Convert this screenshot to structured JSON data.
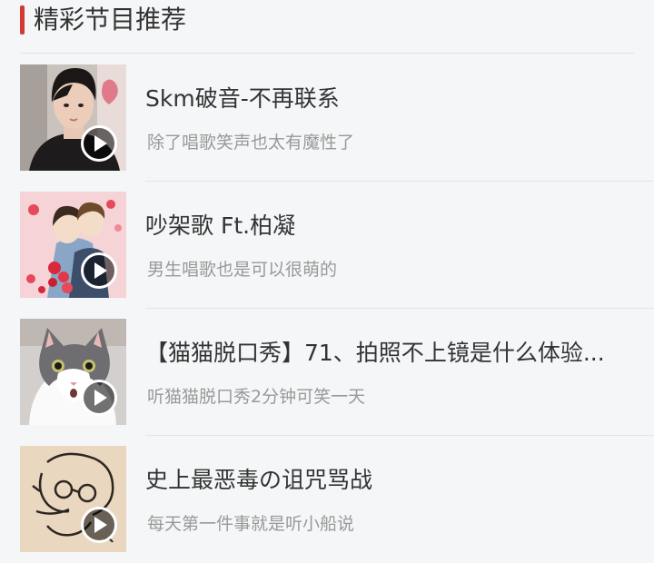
{
  "section": {
    "title": "精彩节目推荐",
    "accent_color": "#d33a31"
  },
  "items": [
    {
      "title": "Skm破音-不再联系",
      "subtitle": "除了唱歌笑声也太有魔性了",
      "thumbnail": "portrait-boy-photo",
      "play_icon": "play-circle-icon"
    },
    {
      "title": "吵架歌 Ft.柏凝",
      "subtitle": "男生唱歌也是可以很萌的",
      "thumbnail": "anime-couple-illustration",
      "play_icon": "play-circle-icon"
    },
    {
      "title": "【猫猫脱口秀】71、拍照不上镜是什么体验...",
      "subtitle": "听猫猫脱口秀2分钟可笑一天",
      "thumbnail": "gray-white-cat-photo",
      "play_icon": "play-circle-icon"
    },
    {
      "title": "史上最恶毒の诅咒骂战",
      "subtitle": "每天第一件事就是听小船说",
      "thumbnail": "line-sketch-drawing",
      "play_icon": "play-circle-icon"
    }
  ]
}
